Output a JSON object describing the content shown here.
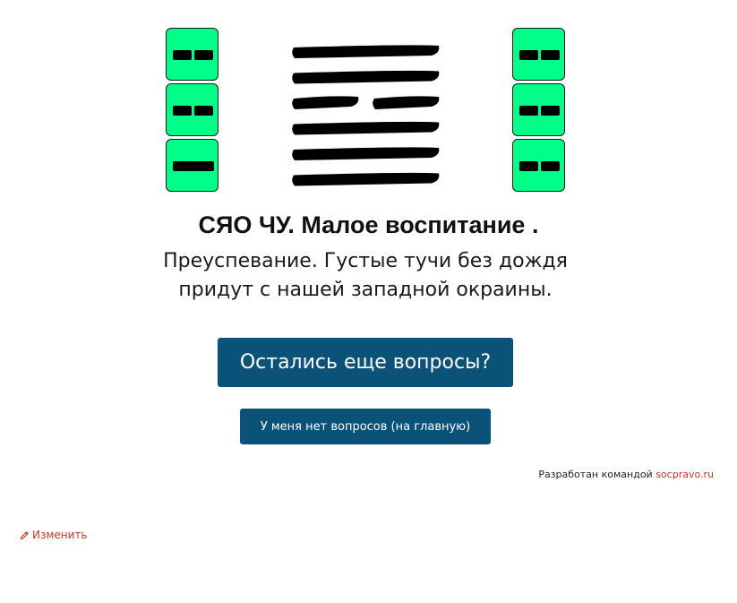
{
  "trigrams": {
    "left": [
      "yin",
      "yin",
      "yang"
    ],
    "right": [
      "yin",
      "yin",
      "yin"
    ]
  },
  "hexagram": {
    "lines_top_to_bottom": [
      "yang",
      "yang",
      "yin",
      "yang",
      "yang",
      "yang"
    ],
    "color": "#000000"
  },
  "title": "СЯО ЧУ. Малое воспитание .",
  "description_line1": "Преуспевание. Густые тучи без дождя",
  "description_line2": "придут с нашей западной окраины.",
  "buttons": {
    "questions_label": "Остались еще вопросы?",
    "home_label": "У меня нет вопросов (на главную)"
  },
  "footer": {
    "credit_prefix": "Разработан командой",
    "credit_link": "socpravo.ru"
  },
  "edit": {
    "label": "Изменить",
    "icon": "pencil-icon"
  },
  "colors": {
    "tile": "#00ff88",
    "button": "#0b5279",
    "link": "#c0392b"
  }
}
